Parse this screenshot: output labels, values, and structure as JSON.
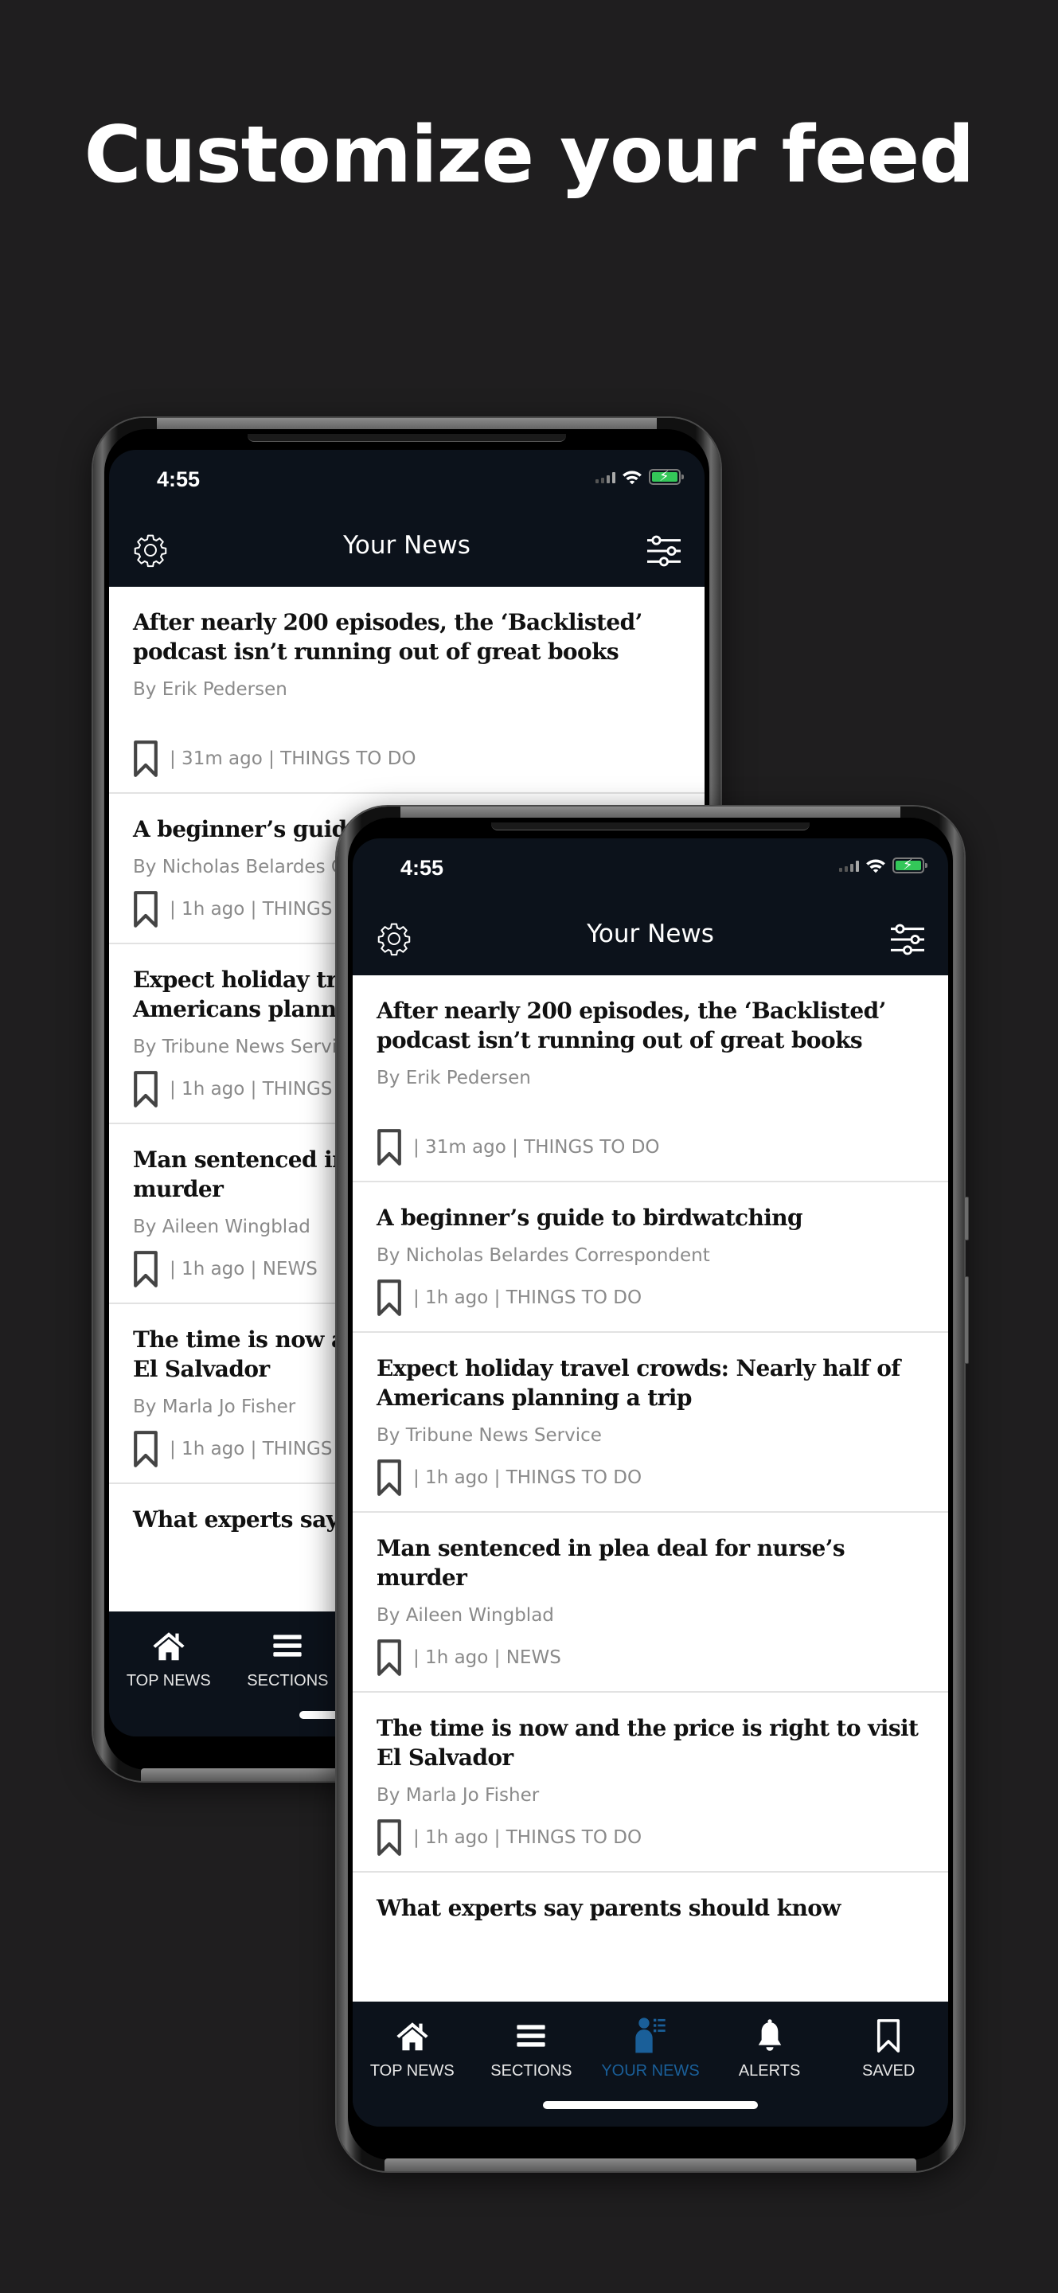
{
  "promo": {
    "headline": "Customize your feed"
  },
  "status_bar": {
    "time": "4:55",
    "icons": [
      "cellular-signal-icon",
      "wifi-icon",
      "battery-charging-icon"
    ]
  },
  "app_bar": {
    "title": "Your News",
    "left_icon": "gear-icon",
    "right_icon": "filter-sliders-icon"
  },
  "articles": [
    {
      "headline": "After nearly 200 episodes, the ‘Backlisted’ podcast isn’t running out of great books",
      "byline": "By Erik Pedersen",
      "meta": "| 31m ago | THINGS TO DO"
    },
    {
      "headline": "A beginner’s guide to birdwatching",
      "byline": "By Nicholas Belardes Correspondent",
      "meta": "| 1h ago | THINGS TO DO"
    },
    {
      "headline": "Expect holiday travel crowds: Nearly half of Americans planning a trip",
      "byline": "By Tribune News Service",
      "meta": "| 1h ago | THINGS TO DO"
    },
    {
      "headline": "Man sentenced in plea deal for nurse’s murder",
      "byline": "By Aileen Wingblad",
      "meta": "| 1h ago | NEWS"
    },
    {
      "headline": "The time is now and the price is right to visit El Salvador",
      "byline": "By Marla Jo Fisher",
      "meta": "| 1h ago | THINGS TO DO"
    },
    {
      "headline": "What experts say parents should know",
      "byline": "",
      "meta": ""
    }
  ],
  "bottom_nav": {
    "tabs": [
      {
        "label": "TOP NEWS",
        "icon": "home-icon",
        "active": false
      },
      {
        "label": "SECTIONS",
        "icon": "menu-lines-icon",
        "active": false
      },
      {
        "label": "YOUR NEWS",
        "icon": "person-list-icon",
        "active": true
      },
      {
        "label": "ALERTS",
        "icon": "bell-icon",
        "active": false
      },
      {
        "label": "SAVED",
        "icon": "bookmark-icon",
        "active": false
      }
    ],
    "active_color": "#1a5f99"
  },
  "colors": {
    "background": "#1f1e1f",
    "app_header": "#0c121b",
    "battery": "#34c759",
    "meta_text": "#8a8a8a"
  }
}
